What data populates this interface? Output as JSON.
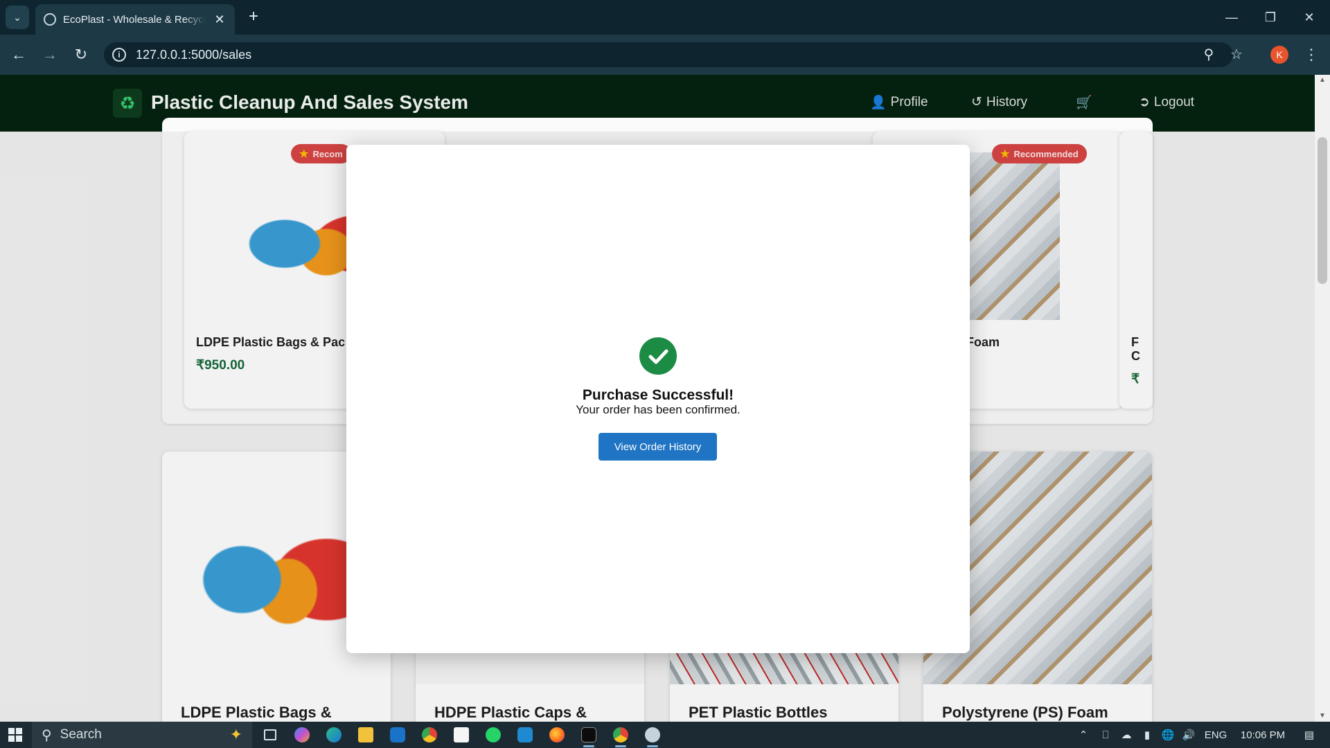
{
  "browser": {
    "tab_title": "EcoPlast - Wholesale & Recycled Plastics",
    "url": "127.0.0.1:5000/sales",
    "profile_initial": "K"
  },
  "site": {
    "title": "Plastic Cleanup And Sales System",
    "nav": {
      "profile": "Profile",
      "history": "History",
      "logout": "Logout"
    }
  },
  "products_top": [
    {
      "badge": "Recom",
      "name": "LDPE Plastic Bags & Pac",
      "price": "₹950.00"
    },
    {
      "badge": "Recommended",
      "name": "(PS) Foam",
      "price": ""
    },
    {
      "badge": "",
      "name": "F",
      "name2": "C",
      "price": "₹"
    }
  ],
  "products_bottom": [
    {
      "name": "LDPE Plastic Bags &"
    },
    {
      "name": "HDPE Plastic Caps &"
    },
    {
      "name": "PET Plastic Bottles"
    },
    {
      "name": "Polystyrene (PS) Foam"
    }
  ],
  "modal": {
    "title": "Purchase Successful!",
    "message": "Your order has been confirmed.",
    "button": "View Order History"
  },
  "taskbar": {
    "search_placeholder": "Search",
    "language": "ENG",
    "time": "10:06 PM"
  }
}
